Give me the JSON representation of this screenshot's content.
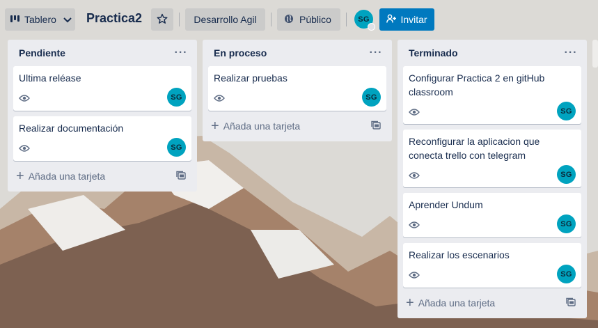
{
  "topbar": {
    "view_label": "Tablero",
    "board_title": "Practica2",
    "team_label": "Desarrollo Agil",
    "visibility_label": "Público",
    "avatar_initials": "SG",
    "invite_label": "Invitar"
  },
  "lists": [
    {
      "title": "Pendiente",
      "more": "···",
      "add_label": "Añada una tarjeta",
      "cards": [
        {
          "title": "Ultima reléase",
          "avatar": "SG"
        },
        {
          "title": "Realizar documentación",
          "avatar": "SG"
        }
      ]
    },
    {
      "title": "En proceso",
      "more": "···",
      "add_label": "Añada una tarjeta",
      "cards": [
        {
          "title": "Realizar pruebas",
          "avatar": "SG"
        }
      ]
    },
    {
      "title": "Terminado",
      "more": "···",
      "add_label": "Añada una tarjeta",
      "cards": [
        {
          "title": "Configurar Practica 2 en gitHub classroom",
          "avatar": "SG"
        },
        {
          "title": "Reconfigurar la aplicacion que conecta trello con telegram",
          "avatar": "SG"
        },
        {
          "title": "Aprender Undum",
          "avatar": "SG"
        },
        {
          "title": "Realizar los escenarios",
          "avatar": "SG"
        }
      ]
    }
  ],
  "colors": {
    "accent": "#0079bf",
    "avatar": "#00a3bf",
    "list_bg": "#ebecf0"
  }
}
